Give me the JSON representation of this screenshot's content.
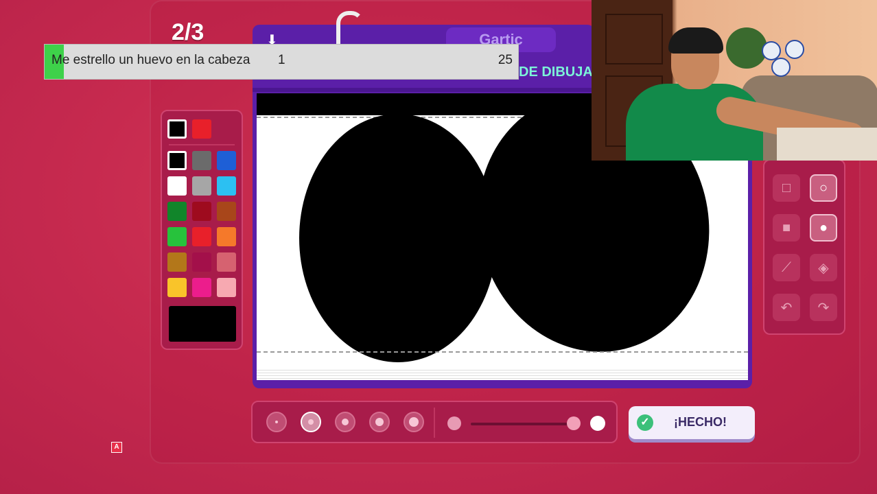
{
  "game": {
    "round": "2/3",
    "brand": "Gartic",
    "mode_title": "DE DIBUJA",
    "download_icon": "download-icon"
  },
  "prompt_bar": {
    "text": "Me estrello un huevo en la cabeza",
    "number_left": "1",
    "number_right": "25",
    "progress_fraction": 0.04,
    "progress_color": "#3ed14a"
  },
  "palette": {
    "recent": [
      "#000000",
      "#e8202a"
    ],
    "colors": [
      "#000000",
      "#6b6b6b",
      "#1e5fd6",
      "#ffffff",
      "#a6a6a6",
      "#2cc0f2",
      "#11852a",
      "#9e0b1e",
      "#a8461a",
      "#27c23c",
      "#e8202a",
      "#f5792a",
      "#b3771a",
      "#a3104a",
      "#d66270",
      "#f9c42a",
      "#ec1d8c",
      "#f7a9b1"
    ],
    "selected_color": "#000000"
  },
  "tools": {
    "items": [
      {
        "name": "square-outline-tool-icon",
        "glyph": "□",
        "active": false
      },
      {
        "name": "ellipse-outline-tool-icon",
        "glyph": "○",
        "active": true
      },
      {
        "name": "square-filled-tool-icon",
        "glyph": "■",
        "active": false
      },
      {
        "name": "ellipse-filled-tool-icon",
        "glyph": "●",
        "active": true
      },
      {
        "name": "line-tool-icon",
        "glyph": "⟋",
        "active": false
      },
      {
        "name": "fill-bucket-tool-icon",
        "glyph": "◈",
        "active": false
      },
      {
        "name": "undo-icon",
        "glyph": "↶",
        "active": false
      },
      {
        "name": "redo-icon",
        "glyph": "↷",
        "active": false
      }
    ]
  },
  "brush_sizes": {
    "selected_index": 1,
    "count": 5
  },
  "opacity_slider": {
    "value_fraction": 0.95
  },
  "done_button": {
    "label": "¡HECHO!",
    "icon": "check-circle-icon"
  },
  "badge": {
    "label": "A"
  }
}
